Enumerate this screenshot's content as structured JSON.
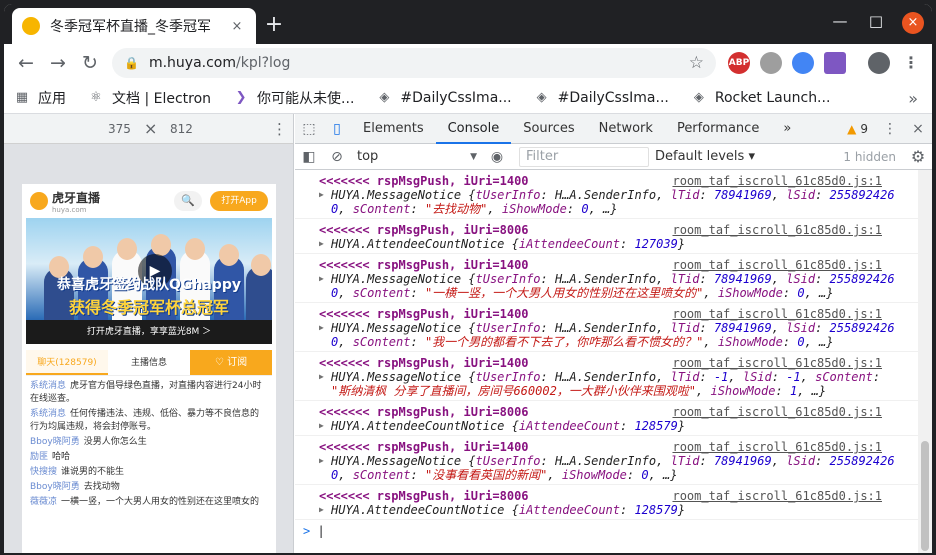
{
  "tab": {
    "title": "冬季冠军杯直播_冬季冠军",
    "close": "×",
    "new_tab": "+"
  },
  "window": {
    "minimize": "—",
    "maximize": "□",
    "close": "×"
  },
  "toolbar": {
    "back": "←",
    "forward": "→",
    "reload": "↻",
    "url_host": "m.huya.com",
    "url_path": "/kpl?log",
    "star": "☆",
    "menu": "⋮"
  },
  "extensions": [
    {
      "label": "ABP",
      "color": "#d32f2f"
    },
    {
      "label": "",
      "color": "#9e9e9e"
    },
    {
      "label": "",
      "color": "#4285f4"
    },
    {
      "label": "",
      "color": "#7e57c2"
    }
  ],
  "bookmarks": [
    {
      "icon": "apps-icon",
      "label": "应用"
    },
    {
      "icon": "electron-icon",
      "label": "文档 | Electron"
    },
    {
      "icon": "chevron-icon",
      "label": "你可能从未使..."
    },
    {
      "icon": "codepen-icon",
      "label": "#DailyCssIma..."
    },
    {
      "icon": "codepen-icon",
      "label": "#DailyCssIma..."
    },
    {
      "icon": "codepen-icon",
      "label": "Rocket Launch..."
    }
  ],
  "bookmarks_more": "»",
  "device": {
    "width": "375",
    "x": "×",
    "height": "812",
    "menu": "⋮"
  },
  "phone": {
    "brand": "虎牙直播",
    "brand_sub": "huya.com",
    "search": "🔍",
    "open_app": "打开App",
    "banner_line1": "恭喜虎牙签约战队QGhappy",
    "banner_line2": "获得冬季冠军杯总冠军",
    "download": "打开虎牙直播，享享蓝光8M ＞",
    "tabs": [
      "聊天(128579)",
      "主播信息",
      "订阅"
    ],
    "chat": [
      {
        "user": "系统消息",
        "text": "虎牙官方倡导绿色直播，对直播内容进行24小时在线巡查。"
      },
      {
        "user": "系统消息",
        "text": "任何传播违法、违规、低俗、暴力等不良信息的行为均属违规，将会封停账号。"
      },
      {
        "user": "Bboy晓阿勇",
        "text": "没男人你怎么生"
      },
      {
        "user": "励匪",
        "text": "哈哈"
      },
      {
        "user": "快搜搜",
        "text": "谁说男的不能生"
      },
      {
        "user": "Bboy晓阿勇",
        "text": "去找动物"
      },
      {
        "user": "薇薇凉",
        "text": "一横一竖，一个大男人用女的性别还在这里喷女的"
      }
    ]
  },
  "devtools": {
    "tabs": [
      "Elements",
      "Console",
      "Sources",
      "Network",
      "Performance"
    ],
    "active_tab": "Console",
    "more": "»",
    "warnings": "9",
    "menu": "⋮",
    "close": "×",
    "context": "top",
    "filter_placeholder": "Filter",
    "levels": "Default levels ▾",
    "hidden": "1 hidden"
  },
  "console": [
    {
      "head": "<<<<<<< rspMsgPush, iUri=1400",
      "src": "room_taf_iscroll_61c85d0.js:1",
      "type": "msg",
      "lines": [
        "HUYA.MessageNotice {tUserInfo: H…A.SenderInfo, lTid: 78941969, lSid: 255892426",
        "0, sContent: \"去找动物\", iShowMode: 0, …}"
      ]
    },
    {
      "head": "<<<<<<< rspMsgPush, iUri=8006",
      "src": "room_taf_iscroll_61c85d0.js:1",
      "type": "count",
      "lines": [
        "HUYA.AttendeeCountNotice {iAttendeeCount: 127039}"
      ]
    },
    {
      "head": "<<<<<<< rspMsgPush, iUri=1400",
      "src": "room_taf_iscroll_61c85d0.js:1",
      "type": "msg",
      "lines": [
        "HUYA.MessageNotice {tUserInfo: H…A.SenderInfo, lTid: 78941969, lSid: 255892426",
        "0, sContent: \"一横一竖，一个大男人用女的性别还在这里喷女的\", iShowMode: 0, …}"
      ]
    },
    {
      "head": "<<<<<<< rspMsgPush, iUri=1400",
      "src": "room_taf_iscroll_61c85d0.js:1",
      "type": "msg",
      "lines": [
        "HUYA.MessageNotice {tUserInfo: H…A.SenderInfo, lTid: 78941969, lSid: 255892426",
        "0, sContent: \"我一个男的都看不下去了，你咋那么看不惯女的？\", iShowMode: 0, …}"
      ]
    },
    {
      "head": "<<<<<<< rspMsgPush, iUri=1400",
      "src": "room_taf_iscroll_61c85d0.js:1",
      "type": "msg",
      "lines": [
        "HUYA.MessageNotice {tUserInfo: H…A.SenderInfo, lTid: -1, lSid: -1, sContent:",
        "\"斯纳清枫 分享了直播间，房间号660002，一大群小伙伴来围观啦\", iShowMode: 1, …}"
      ]
    },
    {
      "head": "<<<<<<< rspMsgPush, iUri=8006",
      "src": "room_taf_iscroll_61c85d0.js:1",
      "type": "count",
      "lines": [
        "HUYA.AttendeeCountNotice {iAttendeeCount: 128579}"
      ]
    },
    {
      "head": "<<<<<<< rspMsgPush, iUri=1400",
      "src": "room_taf_iscroll_61c85d0.js:1",
      "type": "msg",
      "lines": [
        "HUYA.MessageNotice {tUserInfo: H…A.SenderInfo, lTid: 78941969, lSid: 255892426",
        "0, sContent: \"没事看看英国的新闻\", iShowMode: 0, …}"
      ]
    },
    {
      "head": "<<<<<<< rspMsgPush, iUri=8006",
      "src": "room_taf_iscroll_61c85d0.js:1",
      "type": "count",
      "lines": [
        "HUYA.AttendeeCountNotice {iAttendeeCount: 128579}"
      ]
    }
  ],
  "prompt": ">"
}
